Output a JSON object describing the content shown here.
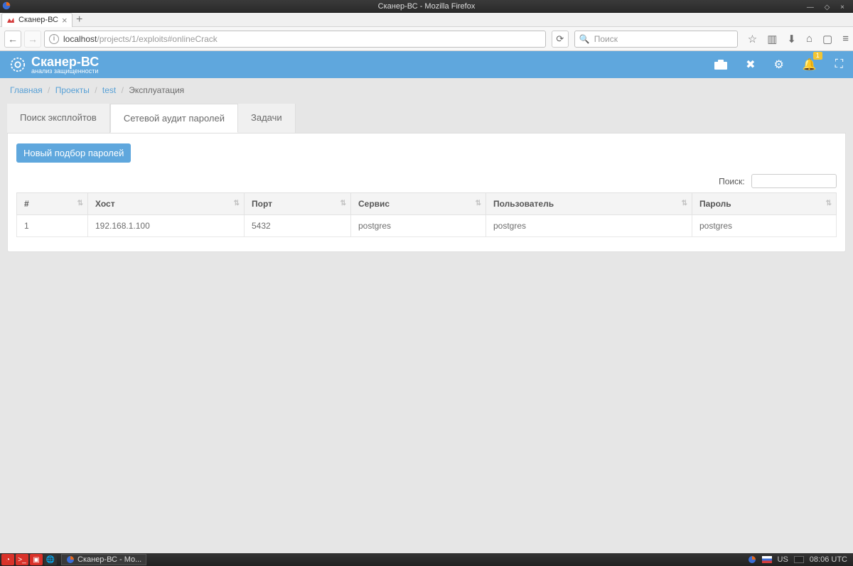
{
  "os": {
    "title": "Сканер-ВС - Mozilla Firefox"
  },
  "browser": {
    "tab_title": "Сканер-ВС",
    "url_prefix": "localhost",
    "url_path": "/projects/1/exploits#onlineCrack",
    "search_placeholder": "Поиск"
  },
  "app": {
    "logo_title": "Сканер-ВС",
    "logo_subtitle": "анализ защищенности",
    "notification_count": "1"
  },
  "breadcrumbs": {
    "home": "Главная",
    "projects": "Проекты",
    "project_name": "test",
    "current": "Эксплуатация"
  },
  "tabs": {
    "search": "Поиск эксплойтов",
    "audit": "Сетевой аудит паролей",
    "tasks": "Задачи"
  },
  "panel": {
    "new_btn": "Новый подбор паролей",
    "search_label": "Поиск:"
  },
  "table": {
    "headers": {
      "num": "#",
      "host": "Хост",
      "port": "Порт",
      "service": "Сервис",
      "user": "Пользователь",
      "password": "Пароль"
    },
    "row": {
      "num": "1",
      "host": "192.168.1.100",
      "port": "5432",
      "service": "postgres",
      "user": "postgres",
      "password": "postgres"
    }
  },
  "taskbar": {
    "task": "Сканер-ВС - Mo...",
    "lang": "US",
    "clock": "08:06 UTC"
  }
}
